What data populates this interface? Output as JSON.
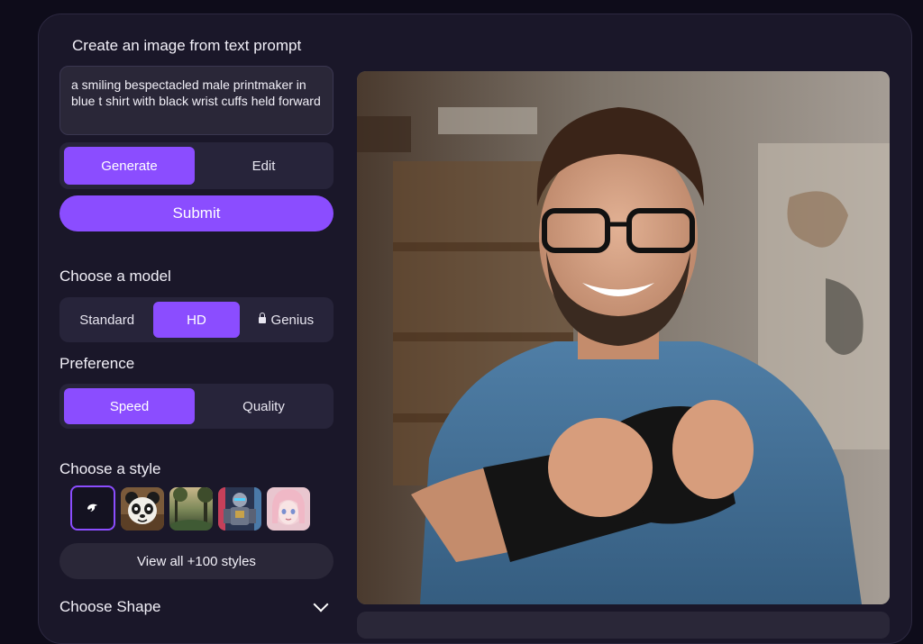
{
  "panel": {
    "title": "Create an image from text prompt",
    "prompt_value": "a smiling bespectacled male printmaker in blue t shirt with black wrist cuffs held forward"
  },
  "mode_tabs": [
    {
      "label": "Generate",
      "active": true
    },
    {
      "label": "Edit",
      "active": false
    }
  ],
  "submit_label": "Submit",
  "model": {
    "heading": "Choose a model",
    "options": [
      {
        "label": "Standard",
        "active": false,
        "locked": false
      },
      {
        "label": "HD",
        "active": true,
        "locked": false
      },
      {
        "label": "Genius",
        "active": false,
        "locked": true
      }
    ]
  },
  "preference": {
    "heading": "Preference",
    "options": [
      {
        "label": "Speed",
        "active": true
      },
      {
        "label": "Quality",
        "active": false
      }
    ]
  },
  "style": {
    "heading": "Choose a style",
    "thumbnails": [
      "no-style-icon",
      "panda",
      "forest-landscape",
      "robot-warrior",
      "anime-girl"
    ],
    "view_all_label": "View all +100 styles"
  },
  "shape": {
    "heading": "Choose Shape"
  },
  "colors": {
    "accent": "#8b4dff",
    "card": "#1a1729",
    "control": "#27243a",
    "background": "#0e0c1a"
  }
}
